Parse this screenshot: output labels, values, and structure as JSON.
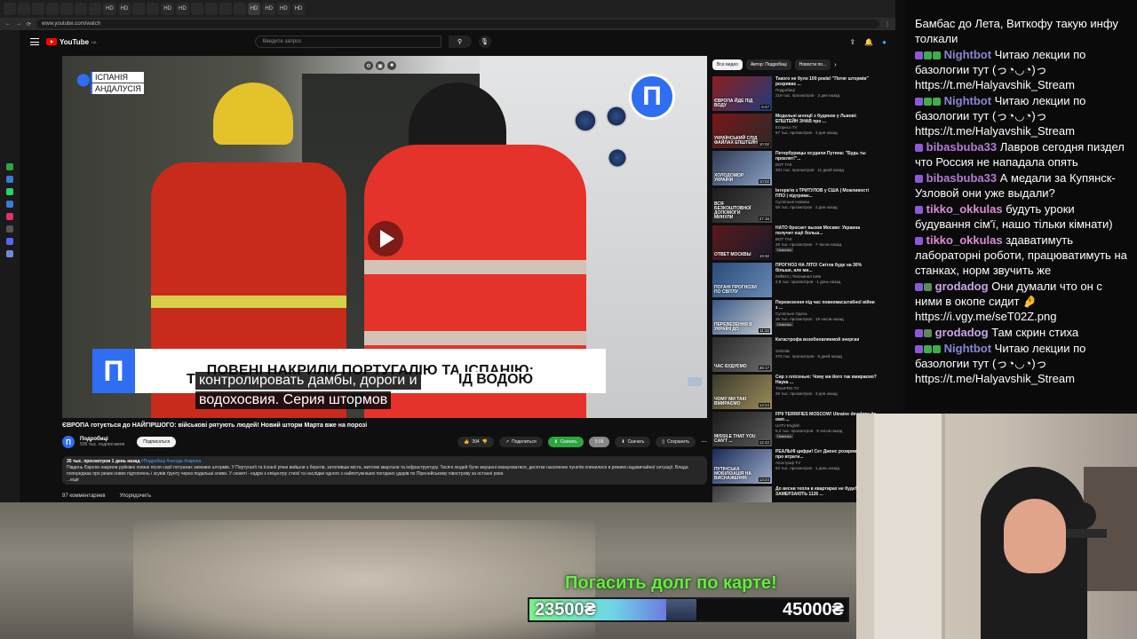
{
  "browser": {
    "tabs": [
      "",
      "",
      "",
      "",
      "",
      "",
      "",
      "HD",
      "HD",
      "",
      "",
      "HD",
      "HD",
      "",
      "",
      "",
      "",
      "HD",
      "HD",
      "HD",
      "HD"
    ],
    "url": "www.youtube.com/watch"
  },
  "youtube": {
    "logo": "YouTube",
    "logo_sup": "UA",
    "search_placeholder": "Введите запрос",
    "player": {
      "location": [
        "ІСПАНІЯ",
        "АНДАЛУСІЯ"
      ],
      "channel_logo": "П",
      "banner_logo": "П",
      "banner_text": "ПОВЕНІ НАКРИЛИ ПОРТУГАЛІЮ ТА ІСПАНІЮ:",
      "subtitles": [
        "контролировать дамбы, дороги и",
        "водохосвия. Серия штормов"
      ],
      "subtitle_peek_left": "Т",
      "subtitle_peek_right": "ІД ВОДОЮ"
    },
    "video_title": "ЄВРОПА готується до НАЙГІРШОГО: військові рятують людей! Новий шторм Марта вже на порозі",
    "channel": {
      "avatar": "П",
      "name": "Подробиці",
      "subs": "505 тыс. подписчиков",
      "subscribe": "Подписаться"
    },
    "actions": {
      "likes": "394",
      "share": "Поделиться",
      "download_app": "Скачать",
      "gray": "5:08",
      "download": "Скачать",
      "save": "Сохранить"
    },
    "description": {
      "meta": "35 тыс. просмотров  1 день назад",
      "tags": "#Подробиці #негода #європа",
      "text": "Південь Європи накрили руйнівні повені після серії потужних зимових штормів. У Португалії та Іспанії річки вийшли з берегів, затопивши міста, житлові квартали та інфраструктуру. Тисячі людей були змушені евакуюватися, десятки населених пунктів опинилися в режимі надзвичайної ситуації. Влада попереджає про ризик нових підтоплень і зсувів ґрунту через подальші зливи. У сюжеті - кадри з епіцентру стихії та наслідки одного з найпотужніших погодних ударів по Піренейському півострову за останні роки.",
      "more": "...ещё"
    },
    "comments_header": [
      "97 комментариев",
      "Упорядочить"
    ],
    "chips": [
      "Все видео",
      "Автор: Подробиці",
      "Новости по..."
    ],
    "recommendations": [
      {
        "thumb_text": "ЄВРОПА ЙДЕ ПІД ВОДУ",
        "dur": "8:47",
        "title": "Такого не було 100 років! \"Потяг штормів\" розриває ...",
        "channel": "Подробиці",
        "views": "219 тыс. просмотров · 2 дня назад",
        "badge": "",
        "c1": "#8b1f1f",
        "c2": "#1f3c7a"
      },
      {
        "thumb_text": "УКРАЇНСЬКИЙ СЛІД ФАЙЛАХ ЕПШТЕЙН",
        "dur": "10:32",
        "title": "Модельні агенції з будинок у Львові: ЕПШТЕЙН ЗНАВ про ...",
        "channel": "Еспресо TV",
        "views": "57 тыс. просмотров · 2 дня назад",
        "badge": "",
        "c1": "#7a1616",
        "c2": "#2a2a2a"
      },
      {
        "thumb_text": "ХОЛОДОМОР УКРАЇНИ",
        "dur": "10:02",
        "title": "Петербуржцы осудили Путина: \"Будь ты проклят!\"...",
        "channel": "BOT TAK",
        "views": "201 тыс. просмотров · 11 дней назад",
        "badge": "",
        "c1": "#2e3b55",
        "c2": "#8aa0c4"
      },
      {
        "thumb_text": "ВСЯ БЕЗКОШТОВНОЇ ДОПОМОГИ МИНУЛИ",
        "dur": "27:16",
        "title": "Інтерв'ю з ТРИТУЛОВ у США | Можливості ППО | підтримк...",
        "channel": "Суспільне Новини",
        "views": "58 тыс. просмотров · 2 дня назад",
        "badge": "",
        "c1": "#1c1c1c",
        "c2": "#4a4a4a"
      },
      {
        "thumb_text": "ОТВЕТ МОСКВЫ",
        "dur": "19:32",
        "title": "НАТО бросает вызов Москве: Украина получит ещё больш...",
        "channel": "BOT TAK",
        "views": "26 тыс. просмотров · 7 часов назад",
        "badge": "Новинка",
        "c1": "#5a1a1a",
        "c2": "#1a1a2a"
      },
      {
        "thumb_text": "ПОГАНІ ПРОГНОЗИ ПО СВІТЛУ",
        "dur": "",
        "title": "ПРОГНОЗ НА ЛІТО! Світла буде на 30% більше, але ми...",
        "channel": "КИЇВ24 | Телеканал Київ",
        "views": "2,9 тыс. просмотров · 1 день назад",
        "badge": "",
        "c1": "#2a4a7a",
        "c2": "#6a8ab4"
      },
      {
        "thumb_text": "ПЕРЕВЕЗЕННЯ В УКРАЇНІ ДО",
        "dur": "11:32",
        "title": "Перевезення під час повномасштабної війни з ...",
        "channel": "Суспільне Одеса",
        "views": "26 тыс. просмотров · 19 часов назад",
        "badge": "Новинка",
        "c1": "#3a5a8a",
        "c2": "#c4c8cc"
      },
      {
        "thumb_text": "ЧАС БУДУЄМО",
        "dur": "28:17",
        "title": "Катастрофа возобновляемой энергии",
        "channel": "SciDrak",
        "views": "370 тыс. просмотров · 8 дней назад",
        "badge": "",
        "c1": "#2a2a2a",
        "c2": "#6a6a6a"
      },
      {
        "thumb_text": "ЧОМУ МИ ТАКІ ВМИРАЄМО",
        "dur": "13:24",
        "title": "Сир з плісенью: Чому ми його так вмираємо? Наука ...",
        "channel": "TimeFRG.TV",
        "views": "26 тыс. просмотров · 2 дня назад",
        "badge": "",
        "c1": "#3a3a2a",
        "c2": "#9a8a5a"
      },
      {
        "thumb_text": "MISSILE THAT YOU CAN'T ...",
        "dur": "12:42",
        "title": "FP9 TERRIFIES MOSCOW! Ukraine develops its own ...",
        "channel": "UATV English",
        "views": "6,2 тыс. просмотров · 9 часов назад",
        "badge": "Новинка",
        "c1": "#1a1a1a",
        "c2": "#5a5a5a"
      },
      {
        "thumb_text": "ПУТІНСЬКА МОБІЛІЗАЦІЯ НА ВИСНАЖЕННЯ",
        "dur": "13:24",
        "title": "РЕАЛЬНІ цифри! Сет Джонс розкрив ПРАВДУ про втрати...",
        "channel": "Апостроф TV",
        "views": "84 тыс. просмотров · 1 день назад",
        "badge": "",
        "c1": "#1a2a5a",
        "c2": "#9aaac4"
      },
      {
        "thumb_text": "",
        "dur": "",
        "title": "До весни тепла в квартирах не буде! ЗАМЕРЗАЮТЬ 1126 ...",
        "channel": "",
        "views": "",
        "badge": "",
        "c1": "#3a3a3a",
        "c2": "#aaaaaa"
      }
    ]
  },
  "chat": [
    {
      "user": "",
      "color": "#ffffff",
      "text": "Бамбас до Лета, Виткофу такую инфу толкали",
      "badges": []
    },
    {
      "user": "Nightbot",
      "color": "#8a84d6",
      "text": "Читаю лекции по базологии тут (っ◔◡◔)っ https://t.me/Halyavshik_Stream",
      "badges": [
        "#8a5ad6",
        "#3fae4d",
        "#3fae4d"
      ]
    },
    {
      "user": "Nightbot",
      "color": "#8a84d6",
      "text": "Читаю лекции по базологии тут (っ◔◡◔)っ https://t.me/Halyavshik_Stream",
      "badges": [
        "#8a5ad6",
        "#3fae4d",
        "#3fae4d"
      ]
    },
    {
      "user": "bibasbuba33",
      "color": "#b77ad6",
      "text": "Лавров сегодня пиздел что Россия не нападала опять",
      "badges": [
        "#8a5ad6"
      ]
    },
    {
      "user": "bibasbuba33",
      "color": "#b77ad6",
      "text": "А медали за Купянск-Узловой они уже выдали?",
      "badges": [
        "#8a5ad6"
      ]
    },
    {
      "user": "tikko_okkulas",
      "color": "#d98bd6",
      "text": "будуть уроки будування сім'ї, нашо тільки кімнати)",
      "badges": [
        "#8a5ad6"
      ]
    },
    {
      "user": "tikko_okkulas",
      "color": "#d98bd6",
      "text": "здаватимуть лабораторні роботи, працюватимуть на станках, норм звучить же",
      "badges": [
        "#8a5ad6"
      ]
    },
    {
      "user": "grodadog",
      "color": "#c9a6e6",
      "text": "Они думали что он с ними в окопе сидит 🤌 https://i.vgy.me/seT02Z.png",
      "badges": [
        "#8a5ad6",
        "#5a8a5a"
      ]
    },
    {
      "user": "grodadog",
      "color": "#c9a6e6",
      "text": "Там скрин стиха",
      "badges": [
        "#8a5ad6",
        "#5a8a5a"
      ]
    },
    {
      "user": "Nightbot",
      "color": "#8a84d6",
      "text": "Читаю лекции по базологии тут (っ◔◡◔)っ https://t.me/Halyavshik_Stream",
      "badges": [
        "#8a5ad6",
        "#3fae4d",
        "#3fae4d"
      ]
    }
  ],
  "goal": {
    "title": "Погасить долг по карте!",
    "current": "23500₴",
    "target": "45000₴",
    "progress": 0.52
  }
}
